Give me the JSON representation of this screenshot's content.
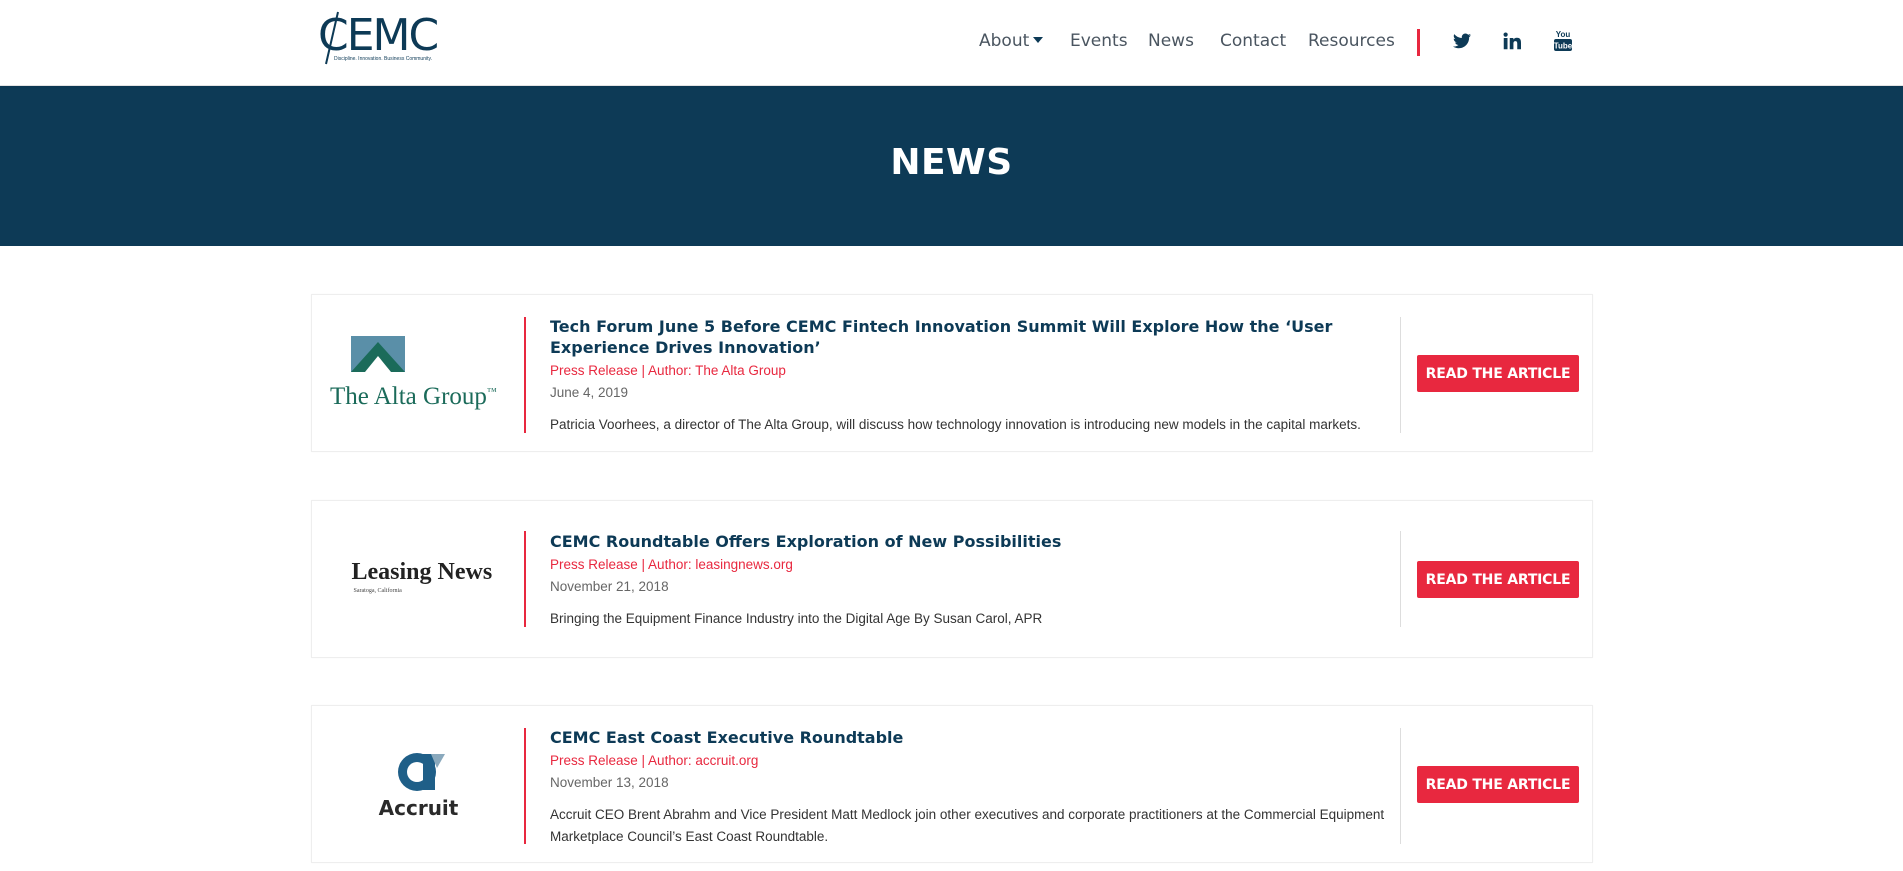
{
  "brand": {
    "logo_text": "CEMC",
    "tagline": "Discipline. Innovation. Business Community.",
    "primary_color": "#0d3a56",
    "accent_color": "#e8283f"
  },
  "nav": {
    "items": [
      {
        "label": "About",
        "has_dropdown": true
      },
      {
        "label": "Events"
      },
      {
        "label": "News"
      },
      {
        "label": "Contact"
      },
      {
        "label": "Resources"
      }
    ],
    "social": [
      {
        "icon": "twitter-icon"
      },
      {
        "icon": "linkedin-icon"
      },
      {
        "icon": "youtube-icon",
        "label": "You Tube"
      }
    ]
  },
  "hero": {
    "title": "NEWS"
  },
  "articles": [
    {
      "logo": "The Alta Group",
      "logo_mark": "™",
      "title": "Tech Forum June 5 Before CEMC Fintech Innovation Summit Will Explore How the ‘User Experience Drives Innovation’",
      "meta": "Press Release | Author: The Alta Group",
      "date": "June 4, 2019",
      "description": "Patricia Voorhees, a director of The Alta Group, will discuss how technology innovation is introducing new models in the capital markets.",
      "button": "READ THE ARTICLE"
    },
    {
      "logo": "Leasing News",
      "logo_sub": "Saratoga, California",
      "title": "CEMC Roundtable Offers Exploration of New Possibilities",
      "meta": "Press Release | Author: leasingnews.org",
      "date": "November 21, 2018",
      "description": "Bringing the Equipment Finance Industry into the Digital Age By Susan Carol, APR",
      "button": "READ THE ARTICLE"
    },
    {
      "logo": "Accruit",
      "title": "CEMC East Coast Executive Roundtable",
      "meta": "Press Release | Author: accruit.org",
      "date": "November 13, 2018",
      "description": "Accruit CEO Brent Abrahm and Vice President Matt Medlock join other executives and corporate practitioners at the Commercial Equipment Marketplace Council’s East Coast Roundtable.",
      "button": "READ THE ARTICLE"
    }
  ]
}
